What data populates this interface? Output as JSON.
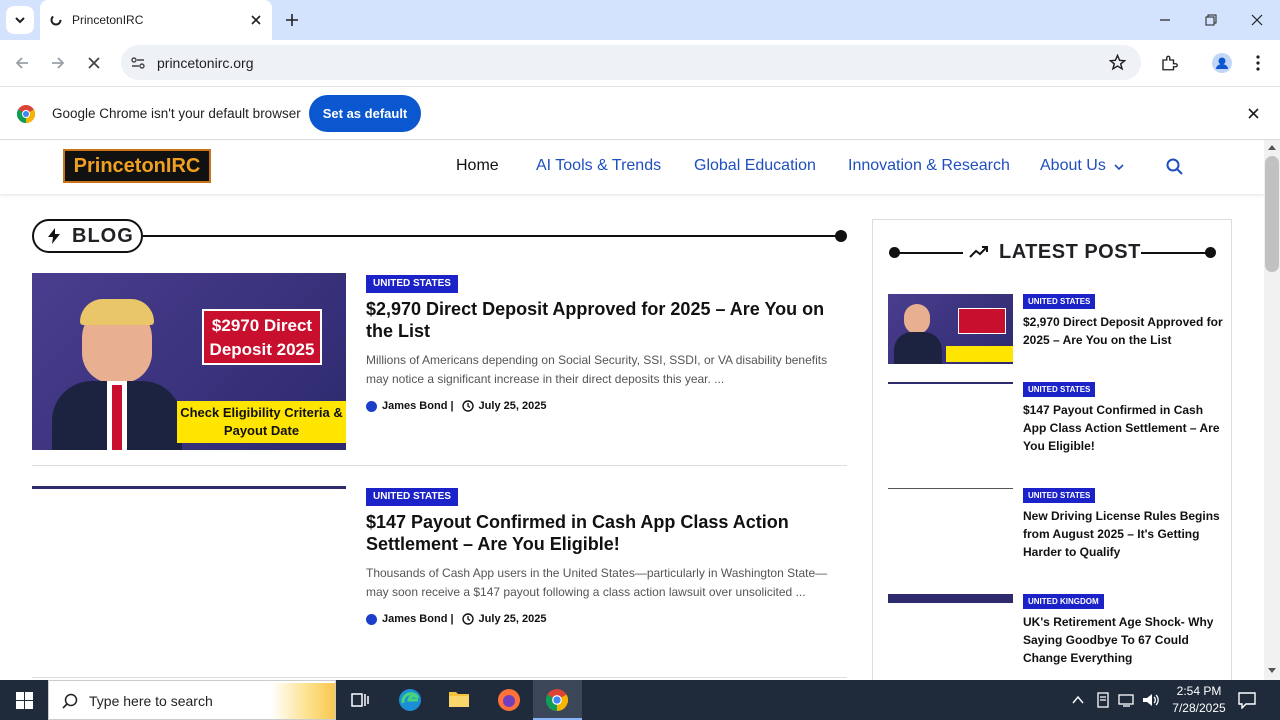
{
  "browser": {
    "tab_title": "PrincetonIRC",
    "url": "princetonirc.org",
    "infobar_message": "Google Chrome isn't your default browser",
    "set_default_label": "Set as default"
  },
  "site": {
    "logo": "PrincetonIRC",
    "nav": [
      "Home",
      "AI Tools & Trends",
      "Global Education",
      "Innovation & Research",
      "About Us"
    ]
  },
  "blog": {
    "heading": "BLOG",
    "posts": [
      {
        "category": "UNITED STATES",
        "title": "$2,970 Direct Deposit Approved for 2025 – Are You on the List",
        "excerpt": "Millions of Americans depending on Social Security, SSI, SSDI, or VA disability benefits may notice a significant increase in their direct deposits this year. ...",
        "author": "James Bond |",
        "date": "July 25, 2025",
        "thumb_text_1": "$2970 Direct Deposit 2025",
        "thumb_text_2": "Check Eligibility Criteria & Payout Date"
      },
      {
        "category": "UNITED STATES",
        "title": "$147 Payout Confirmed in Cash App Class Action Settlement – Are You Eligible!",
        "excerpt": "Thousands of Cash App users in the United States—particularly in Washington State—may soon receive a $147 payout following a class action lawsuit over unsolicited ...",
        "author": "James Bond |",
        "date": "July 25, 2025"
      }
    ]
  },
  "sidebar": {
    "heading": "LATEST POST",
    "items": [
      {
        "category": "UNITED STATES",
        "title": "$2,970 Direct Deposit Approved for 2025 – Are You on the List"
      },
      {
        "category": "UNITED STATES",
        "title": "$147 Payout Confirmed in Cash App Class Action Settlement – Are You Eligible!"
      },
      {
        "category": "UNITED STATES",
        "title": "New Driving License Rules Begins from August 2025 – It's Getting Harder to Qualify"
      },
      {
        "category": "UNITED KINGDOM",
        "title": "UK's Retirement Age Shock- Why Saying Goodbye To 67 Could Change Everything"
      }
    ]
  },
  "taskbar": {
    "search_placeholder": "Type here to search",
    "time": "2:54 PM",
    "date": "7/28/2025"
  },
  "colors": {
    "accent_blue": "#0b57d0",
    "badge_blue": "#1b22c8",
    "nav_blue": "#1f4fbf"
  }
}
